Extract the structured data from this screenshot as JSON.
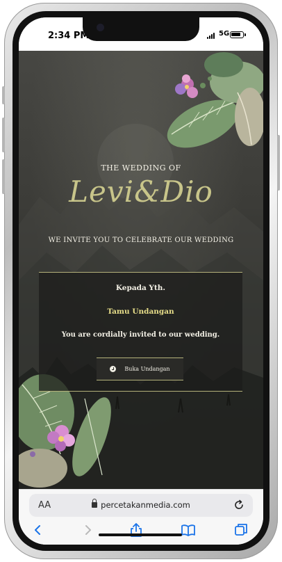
{
  "status_bar": {
    "time": "2:34 PM",
    "network": "5G"
  },
  "invitation": {
    "heading": "THE WEDDING OF",
    "couple_names": "Levi&Dio",
    "invite_line": "WE INVITE YOU TO CELEBRATE OUR WEDDING",
    "card": {
      "salutation": "Kepada Yth.",
      "guest_name": "Tamu Undangan",
      "message": "You are cordially invited to our wedding.",
      "open_button_label": "Buka Undangan"
    },
    "colors": {
      "accent_gold": "#c8c58a",
      "guest_yellow": "#e8df8a",
      "background": "#3c3c38"
    }
  },
  "browser": {
    "text_size_label": "AA",
    "url": "percetakanmedia.com",
    "toolbar_icons": [
      "back-icon",
      "forward-icon",
      "share-icon",
      "bookmarks-icon",
      "tabs-icon"
    ]
  }
}
